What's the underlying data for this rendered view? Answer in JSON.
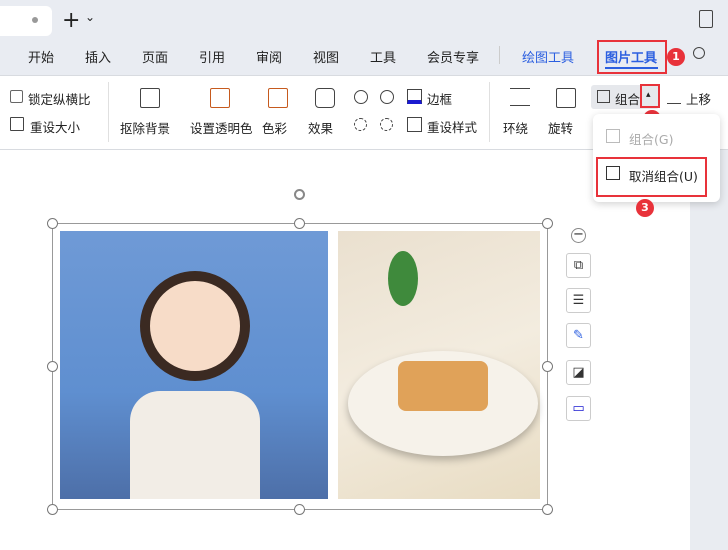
{
  "titlebar": {
    "new_tab": "+",
    "chevron": "⌄"
  },
  "menu": {
    "items": [
      "开始",
      "插入",
      "页面",
      "引用",
      "审阅",
      "视图",
      "工具",
      "会员专享"
    ],
    "drawing_tools": "绘图工具",
    "picture_tools": "图片工具"
  },
  "ribbon": {
    "lock_ratio": "锁定纵横比",
    "reset_size": "重设大小",
    "remove_bg": "抠除背景",
    "set_transparent": "设置透明色",
    "color": "色彩",
    "effect": "效果",
    "border": "边框",
    "reset_style": "重设样式",
    "wrap": "环绕",
    "rotate": "旋转",
    "group": "组合",
    "move_up": "上移"
  },
  "dropdown": {
    "group": "组合(G)",
    "ungroup": "取消组合(U)"
  },
  "badges": [
    "1",
    "2",
    "3"
  ],
  "colors": {
    "accent": "#2c5fe0",
    "annotation": "#e8323a"
  }
}
